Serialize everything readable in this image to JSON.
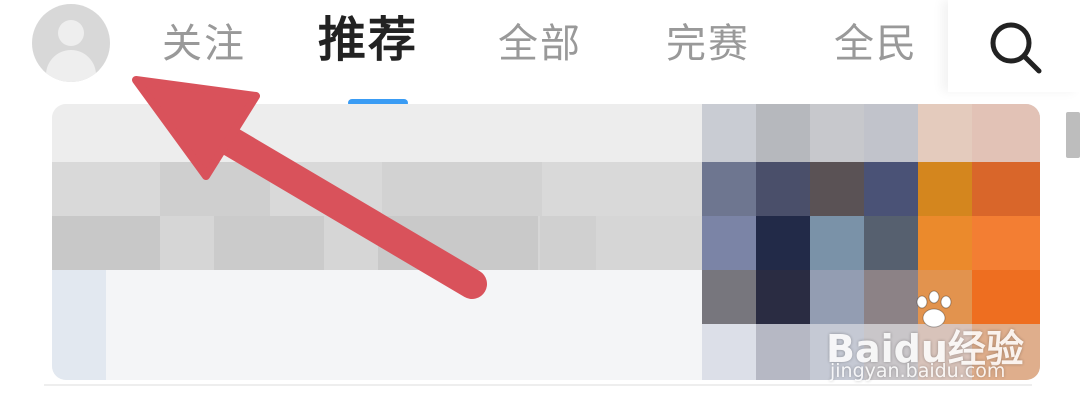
{
  "header": {
    "avatar_icon": "user-avatar-icon",
    "tabs": [
      {
        "label": "关注",
        "active": false
      },
      {
        "label": "推荐",
        "active": true
      },
      {
        "label": "全部",
        "active": false
      },
      {
        "label": "完赛",
        "active": false
      },
      {
        "label": "全民",
        "active": false
      }
    ],
    "search_icon": "search-icon"
  },
  "colors": {
    "accent": "#3a9cf4",
    "arrow": "#d9525b",
    "active_tab": "#222222",
    "inactive_tab": "#999999"
  },
  "watermark": {
    "logo_text": "Bai",
    "logo_text2": "du",
    "logo_suffix": "经验",
    "url": "jingyan.baidu.com"
  }
}
